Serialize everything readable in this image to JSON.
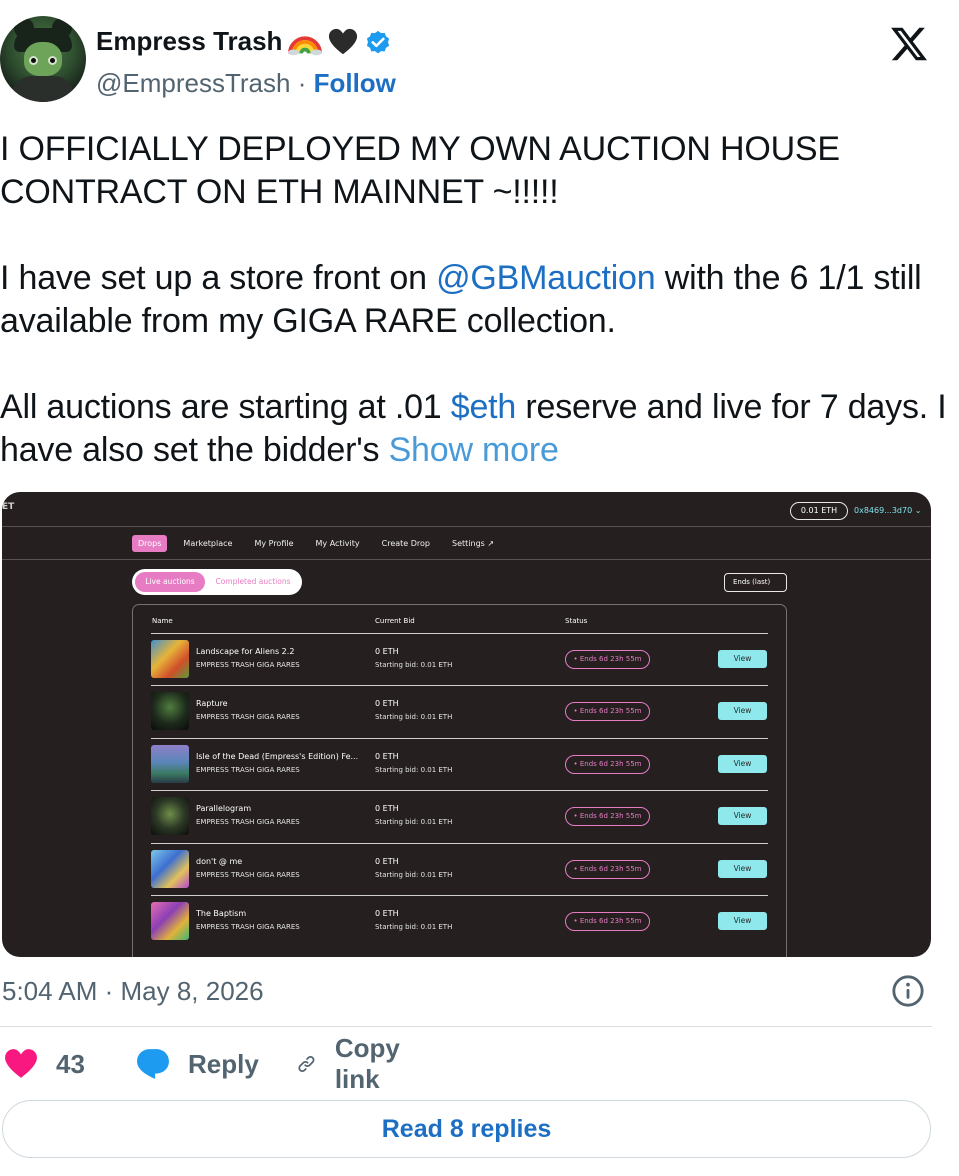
{
  "author": {
    "display_name": "Empress Trash",
    "handle": "@EmpressTrash",
    "separator": " · ",
    "follow_label": "Follow",
    "name_emojis": [
      "rainbow-icon",
      "black-heart-icon"
    ],
    "verified_color": "#1d9bf0"
  },
  "platform_logo": "x-logo-icon",
  "tweet": {
    "para1": "I OFFICIALLY DEPLOYED MY OWN AUCTION HOUSE CONTRACT ON ETH MAINNET ~!!!!!",
    "para2_before": "I have set up a store front on ",
    "para2_mention": "@GBMauction",
    "para2_after": " with the 6 1/1 still available from my GIGA RARE collection.",
    "para3_before": "All auctions are starting at .01 ",
    "para3_cashtag": "$eth",
    "para3_after": " reserve and live for 7 days. I have also set the bidder's ",
    "show_more": "Show more"
  },
  "media": {
    "logo": "ET",
    "wallet_balance": "0.01 ETH",
    "wallet_address": "0x8469...3d70",
    "wallet_chevron": "⌄",
    "nav_tabs": [
      {
        "label": "Drops",
        "active": true
      },
      {
        "label": "Marketplace",
        "active": false
      },
      {
        "label": "My Profile",
        "active": false
      },
      {
        "label": "My Activity",
        "active": false
      },
      {
        "label": "Create Drop",
        "active": false
      },
      {
        "label": "Settings ↗",
        "active": false
      }
    ],
    "toggle_live": "Live auctions",
    "toggle_completed": "Completed auctions",
    "sort_label": "Ends (last)",
    "columns": {
      "name": "Name",
      "bid": "Current Bid",
      "status": "Status"
    },
    "rows": [
      {
        "name": "Landscape for Aliens 2.2",
        "collection": "EMPRESS TRASH GIGA RARES",
        "bid": "0 ETH",
        "starting": "Starting bid: 0.01 ETH",
        "status": "• Ends 6d 23h 55m",
        "action": "View"
      },
      {
        "name": "Rapture",
        "collection": "EMPRESS TRASH GIGA RARES",
        "bid": "0 ETH",
        "starting": "Starting bid: 0.01 ETH",
        "status": "• Ends 6d 23h 55m",
        "action": "View"
      },
      {
        "name": "Isle of the Dead (Empress's Edition) Fe...",
        "collection": "EMPRESS TRASH GIGA RARES",
        "bid": "0 ETH",
        "starting": "Starting bid: 0.01 ETH",
        "status": "• Ends 6d 23h 55m",
        "action": "View"
      },
      {
        "name": "Parallelogram",
        "collection": "EMPRESS TRASH GIGA RARES",
        "bid": "0 ETH",
        "starting": "Starting bid: 0.01 ETH",
        "status": "• Ends 6d 23h 55m",
        "action": "View"
      },
      {
        "name": "don't @ me",
        "collection": "EMPRESS TRASH GIGA RARES",
        "bid": "0 ETH",
        "starting": "Starting bid: 0.01 ETH",
        "status": "• Ends 6d 23h 55m",
        "action": "View"
      },
      {
        "name": "The Baptism",
        "collection": "EMPRESS TRASH GIGA RARES",
        "bid": "0 ETH",
        "starting": "Starting bid: 0.01 ETH",
        "status": "• Ends 6d 23h 55m",
        "action": "View"
      }
    ],
    "colors": {
      "accent_pink": "#e77cc4",
      "accent_cyan": "#8fe9ec",
      "background": "#251f1f"
    }
  },
  "timestamp": "5:04 AM · May 8, 2026",
  "actions": {
    "like_count": "43",
    "reply_label": "Reply",
    "copy_label": "Copy link",
    "like_color": "#f91880",
    "reply_color": "#1d9bf0"
  },
  "read_replies": "Read 8 replies"
}
